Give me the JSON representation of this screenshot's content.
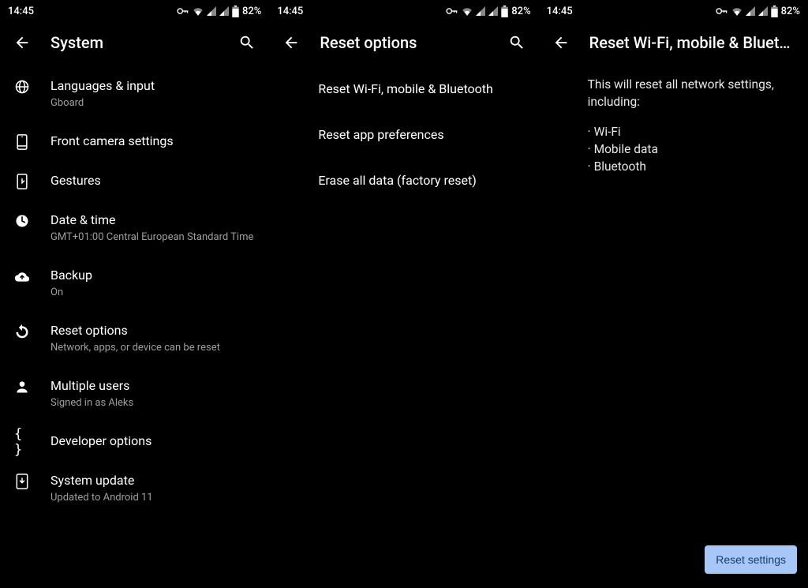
{
  "status": {
    "time": "14:45",
    "battery_pct": "82%"
  },
  "screens": [
    {
      "title": "System",
      "has_search": true,
      "items": [
        {
          "icon": "globe-icon",
          "title": "Languages & input",
          "subtitle": "Gboard"
        },
        {
          "icon": "phone-front-icon",
          "title": "Front camera settings",
          "subtitle": ""
        },
        {
          "icon": "gesture-icon",
          "title": "Gestures",
          "subtitle": ""
        },
        {
          "icon": "clock-icon",
          "title": "Date & time",
          "subtitle": "GMT+01:00 Central European Standard Time"
        },
        {
          "icon": "cloud-up-icon",
          "title": "Backup",
          "subtitle": "On"
        },
        {
          "icon": "reset-icon",
          "title": "Reset options",
          "subtitle": "Network, apps, or device can be reset"
        },
        {
          "icon": "person-icon",
          "title": "Multiple users",
          "subtitle": "Signed in as Aleks"
        },
        {
          "icon": "braces-icon",
          "title": "Developer options",
          "subtitle": ""
        },
        {
          "icon": "update-icon",
          "title": "System update",
          "subtitle": "Updated to Android 11"
        }
      ]
    },
    {
      "title": "Reset options",
      "has_search": true,
      "items": [
        {
          "title": "Reset Wi-Fi, mobile & Bluetooth"
        },
        {
          "title": "Reset app preferences"
        },
        {
          "title": "Erase all data (factory reset)"
        }
      ]
    },
    {
      "title": "Reset Wi-Fi, mobile & Blueto…",
      "has_search": false,
      "intro": "This will reset all network settings, including:",
      "bullets": [
        "Wi-Fi",
        "Mobile data",
        "Bluetooth"
      ],
      "action_label": "Reset settings"
    }
  ]
}
